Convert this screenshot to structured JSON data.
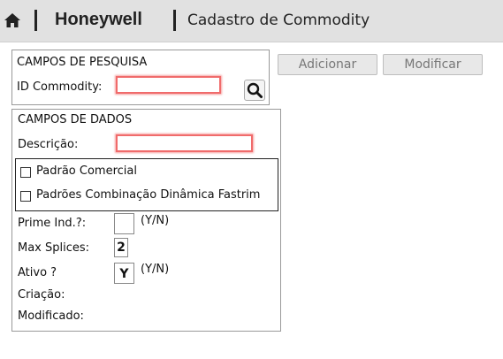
{
  "header": {
    "brand": "Honeywell",
    "title": "Cadastro de Commodity",
    "home_icon": "home-icon"
  },
  "toolbar": {
    "add_label": "Adicionar",
    "modify_label": "Modificar"
  },
  "search": {
    "section_title": "CAMPOS DE PESQUISA",
    "id_label": "ID Commodity:",
    "id_value": "",
    "search_icon": "search-icon"
  },
  "data": {
    "section_title": "CAMPOS DE DADOS",
    "description_label": "Descrição:",
    "description_value": "",
    "checkboxes": [
      {
        "label": "Padrão Comercial",
        "checked": false
      },
      {
        "label": "Padrões Combinação Dinâmica Fastrim",
        "checked": false
      }
    ],
    "prime_label": "Prime Ind.?:",
    "prime_value": "",
    "prime_hint": "(Y/N)",
    "splices_label": "Max Splices:",
    "splices_value": "2",
    "active_label": "Ativo ?",
    "active_value": "Y",
    "active_hint": "(Y/N)",
    "created_label": "Criação:",
    "created_value": "",
    "modified_label": "Modificado:",
    "modified_value": ""
  }
}
